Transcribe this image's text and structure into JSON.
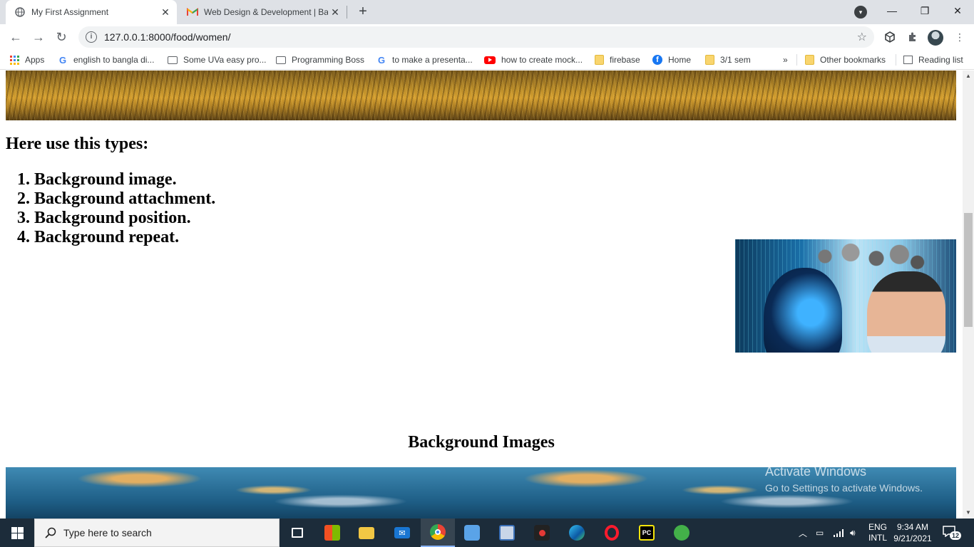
{
  "browser": {
    "tabs": [
      {
        "title": "My First Assignment",
        "favicon": "globe-icon",
        "active": true
      },
      {
        "title": "Web Design & Development | Ba",
        "favicon": "gmail-icon",
        "active": false
      }
    ],
    "url": "127.0.0.1:8000/food/women/",
    "bookmarks": [
      {
        "label": "Apps",
        "icon": "apps-grid-icon"
      },
      {
        "label": "english to bangla di...",
        "icon": "google-icon"
      },
      {
        "label": "Some UVa easy pro...",
        "icon": "monitor-icon"
      },
      {
        "label": "Programming Boss",
        "icon": "monitor-icon"
      },
      {
        "label": "to make a presenta...",
        "icon": "google-icon"
      },
      {
        "label": "how to create mock...",
        "icon": "youtube-icon"
      },
      {
        "label": "firebase",
        "icon": "folder-icon"
      },
      {
        "label": "Home",
        "icon": "facebook-icon"
      },
      {
        "label": "3/1 sem",
        "icon": "folder-icon"
      }
    ],
    "overflow": "»",
    "other_bookmarks": "Other bookmarks",
    "reading_list": "Reading list"
  },
  "page": {
    "types_heading": "Here use this types:",
    "types": [
      "Background image.",
      "Background attachment.",
      "Background position.",
      "Background repeat."
    ],
    "bg_heading": "Background Images"
  },
  "watermark": {
    "line1": "Activate Windows",
    "line2": "Go to Settings to activate Windows."
  },
  "taskbar": {
    "search_placeholder": "Type here to search",
    "apps": [
      "task-view",
      "store",
      "file-explorer",
      "mail",
      "chrome",
      "app-6",
      "app-7",
      "recorder",
      "edge",
      "opera",
      "pycharm",
      "app-12"
    ],
    "lang_line1": "ENG",
    "lang_line2": "INTL",
    "time": "9:34 AM",
    "date": "9/21/2021",
    "notifications": "12"
  }
}
